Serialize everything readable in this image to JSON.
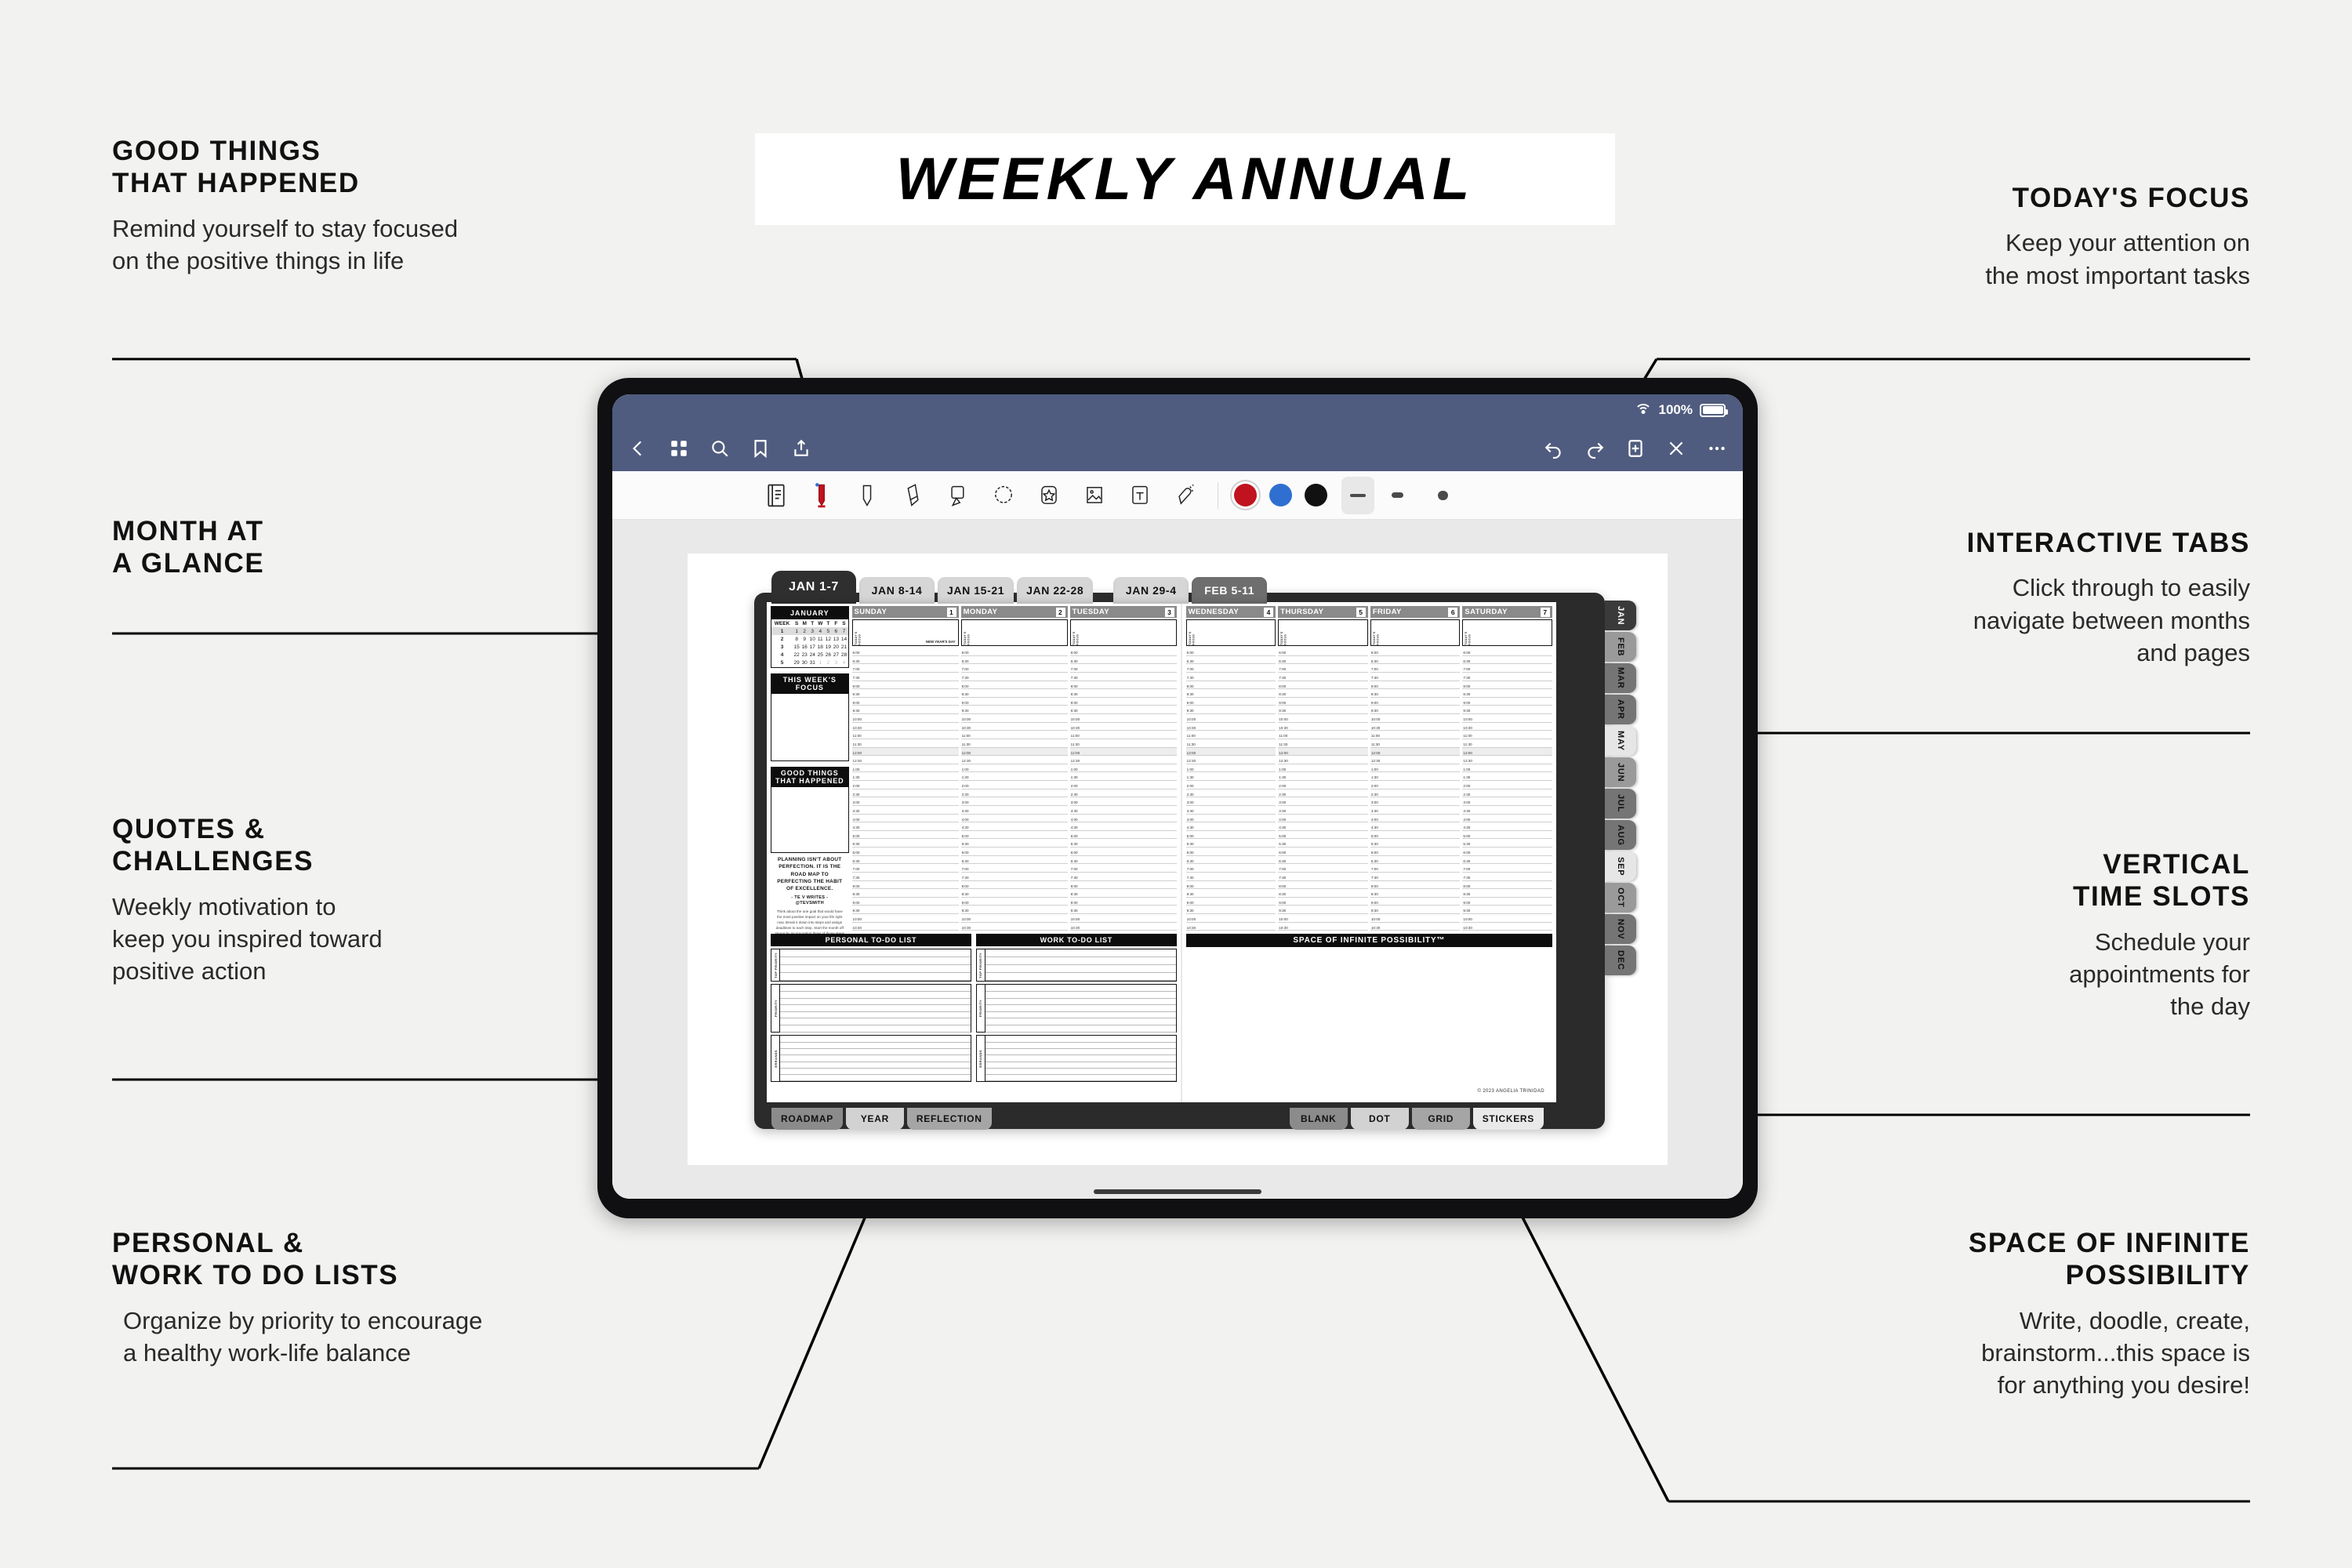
{
  "banner": {
    "title": "WEEKLY ANNUAL"
  },
  "callouts": [
    {
      "key": "good-things",
      "title_line1": "GOOD THINGS",
      "title_line2": "THAT HAPPENED",
      "body_line1": "Remind yourself to stay focused",
      "body_line2": "on the positive things in life"
    },
    {
      "key": "month-at-a-glance",
      "title_line1": "MONTH AT",
      "title_line2": "A GLANCE",
      "body_line1": "",
      "body_line2": ""
    },
    {
      "key": "quotes-challenges",
      "title_line1": "QUOTES &",
      "title_line2": "CHALLENGES",
      "body_line1": "Weekly motivation to",
      "body_line2": "keep you inspired toward",
      "body_line3": "positive action"
    },
    {
      "key": "personal-work-todo",
      "title_line1": "PERSONAL &",
      "title_line2": "WORK TO DO LISTS",
      "body_line1": "Organize by priority to encourage",
      "body_line2": "a healthy work-life balance"
    },
    {
      "key": "todays-focus",
      "title_line1": "TODAY'S FOCUS",
      "body_line1": "Keep your attention on",
      "body_line2": "the most important tasks"
    },
    {
      "key": "interactive-tabs",
      "title_line1": "INTERACTIVE TABS",
      "body_line1": "Click through to easily",
      "body_line2": "navigate between months",
      "body_line3": "and pages"
    },
    {
      "key": "vertical-time-slots",
      "title_line1": "VERTICAL",
      "title_line2": "TIME SLOTS",
      "body_line1": "Schedule your",
      "body_line2": "appointments for",
      "body_line3": "the day"
    },
    {
      "key": "space-of-infinite-possibility",
      "title_line1": "SPACE OF INFINITE",
      "title_line2": "POSSIBILITY",
      "body_line1": "Write, doodle, create,",
      "body_line2": "brainstorm...this space is",
      "body_line3": "for anything you desire!"
    }
  ],
  "ipad": {
    "status": {
      "battery_percent": "100%",
      "wifi_icon": "wifi-icon",
      "battery_icon": "battery-full-icon"
    },
    "navbar": {
      "left_icons": [
        "back-chevron-icon",
        "grid-thumbnails-icon",
        "search-icon",
        "bookmark-icon",
        "share-icon"
      ],
      "right_icons": [
        "undo-icon",
        "redo-icon",
        "add-page-icon",
        "close-pen-icon",
        "more-options-icon"
      ]
    },
    "toolbar": {
      "tools": [
        "reading-mode-icon",
        "pen-icon",
        "highlighter-icon",
        "eraser-icon",
        "lasso-icon",
        "shape-icon",
        "sticker-icon",
        "image-icon",
        "text-box-icon",
        "tape-icon"
      ],
      "colors": [
        "#c1121f",
        "#2f6fd0",
        "#111111"
      ],
      "selected_color": "#c1121f",
      "stroke_widths": [
        "thin",
        "medium",
        "thick"
      ]
    }
  },
  "planner": {
    "week_tabs": [
      {
        "label": "JAN 1-7",
        "state": "active"
      },
      {
        "label": "JAN 8-14",
        "state": "light"
      },
      {
        "label": "JAN 15-21",
        "state": "light"
      },
      {
        "label": "JAN 22-28",
        "state": "light"
      },
      {
        "label": "JAN 29-4",
        "state": "light"
      },
      {
        "label": "FEB 5-11",
        "state": "dark"
      }
    ],
    "mini_calendar": {
      "title": "JANUARY",
      "headers": [
        "WEEK",
        "S",
        "M",
        "T",
        "W",
        "T",
        "F",
        "S"
      ],
      "rows": [
        {
          "week": "1",
          "days": [
            "1",
            "2",
            "3",
            "4",
            "5",
            "6",
            "7"
          ],
          "muted": [],
          "highlight": true
        },
        {
          "week": "2",
          "days": [
            "8",
            "9",
            "10",
            "11",
            "12",
            "13",
            "14"
          ],
          "muted": []
        },
        {
          "week": "3",
          "days": [
            "15",
            "16",
            "17",
            "18",
            "19",
            "20",
            "21"
          ],
          "muted": []
        },
        {
          "week": "4",
          "days": [
            "22",
            "23",
            "24",
            "25",
            "26",
            "27",
            "28"
          ],
          "muted": []
        },
        {
          "week": "5",
          "days": [
            "29",
            "30",
            "31",
            "1",
            "2",
            "3",
            "4"
          ],
          "muted": [
            3,
            4,
            5,
            6
          ]
        }
      ]
    },
    "this_weeks_focus_header": "THIS WEEK'S FOCUS",
    "good_things_header": "GOOD THINGS THAT HAPPENED",
    "quote": {
      "text": "PLANNING ISN'T ABOUT PERFECTION. IT IS THE ROAD MAP TO PERFECTING THE HABIT OF EXCELLENCE.",
      "attribution_line1": "- TE V WRITES -",
      "attribution_line2": "@TEVSMITH",
      "challenge": "Think about the one goal that would have the most positive impact on your life right now. Break it down into steps and assign deadlines to each step. Start the month off strong by incorporating three of those steps into your week."
    },
    "days": [
      {
        "name": "SUNDAY",
        "num": "1",
        "holiday": "NEW YEAR'S DAY",
        "focus_label": "TODAY'S FOCUS"
      },
      {
        "name": "MONDAY",
        "num": "2",
        "holiday": "",
        "focus_label": "TODAY'S FOCUS"
      },
      {
        "name": "TUESDAY",
        "num": "3",
        "holiday": "",
        "focus_label": "TODAY'S FOCUS"
      },
      {
        "name": "WEDNESDAY",
        "num": "4",
        "holiday": "",
        "focus_label": "TODAY'S FOCUS"
      },
      {
        "name": "THURSDAY",
        "num": "5",
        "holiday": "",
        "focus_label": "TODAY'S FOCUS"
      },
      {
        "name": "FRIDAY",
        "num": "6",
        "holiday": "",
        "focus_label": "TODAY'S FOCUS"
      },
      {
        "name": "SATURDAY",
        "num": "7",
        "holiday": "",
        "focus_label": "TODAY'S FOCUS"
      }
    ],
    "time_slots": [
      "6:00",
      "6:30",
      "7:00",
      "7:30",
      "8:00",
      "8:30",
      "9:00",
      "9:30",
      "10:00",
      "10:30",
      "11:00",
      "11:30",
      "12:00",
      "12:30",
      "1:00",
      "1:30",
      "2:00",
      "2:30",
      "3:00",
      "3:30",
      "4:00",
      "4:30",
      "5:00",
      "5:30",
      "6:00",
      "6:30",
      "7:00",
      "7:30",
      "8:00",
      "8:30",
      "9:00",
      "9:30",
      "10:00",
      "10:30"
    ],
    "todo_lists": [
      {
        "title": "PERSONAL TO-DO LIST",
        "groups": [
          {
            "label": "TOP PRIORITY",
            "rows": 4
          },
          {
            "label": "PRIORITY",
            "rows": 7
          },
          {
            "label": "ERRANDS",
            "rows": 7
          }
        ]
      },
      {
        "title": "WORK TO-DO LIST",
        "groups": [
          {
            "label": "TOP PRIORITY",
            "rows": 4
          },
          {
            "label": "PRIORITY",
            "rows": 7
          },
          {
            "label": "ERRANDS",
            "rows": 7
          }
        ]
      }
    ],
    "space_header": "SPACE OF INFINITE POSSIBILITY™",
    "copyright": "© 2023 ANGELIA TRINIDAD",
    "month_tabs": [
      {
        "label": "JAN",
        "tone": "d1"
      },
      {
        "label": "FEB",
        "tone": "d2"
      },
      {
        "label": "MAR",
        "tone": "d3"
      },
      {
        "label": "APR",
        "tone": "d3"
      },
      {
        "label": "MAY",
        "tone": "d4"
      },
      {
        "label": "JUN",
        "tone": "d2"
      },
      {
        "label": "JUL",
        "tone": "d3"
      },
      {
        "label": "AUG",
        "tone": "d3"
      },
      {
        "label": "SEP",
        "tone": "d4"
      },
      {
        "label": "OCT",
        "tone": "d2"
      },
      {
        "label": "NOV",
        "tone": "d3"
      },
      {
        "label": "DEC",
        "tone": "d3"
      }
    ],
    "bottom_tabs_left": [
      {
        "label": "ROADMAP",
        "tone": "g1"
      },
      {
        "label": "YEAR",
        "tone": "g2"
      },
      {
        "label": "REFLECTION",
        "tone": "g3"
      }
    ],
    "bottom_tabs_right": [
      {
        "label": "BLANK",
        "tone": "g1"
      },
      {
        "label": "DOT",
        "tone": "g2"
      },
      {
        "label": "GRID",
        "tone": "g3"
      },
      {
        "label": "STICKERS",
        "tone": "g4"
      }
    ]
  },
  "colors": {
    "page_background": "#f2f2f1",
    "ipad_body": "#101013",
    "navbar": "#505c7f",
    "accent_red": "#c1121f",
    "accent_blue": "#2f6fd0"
  }
}
